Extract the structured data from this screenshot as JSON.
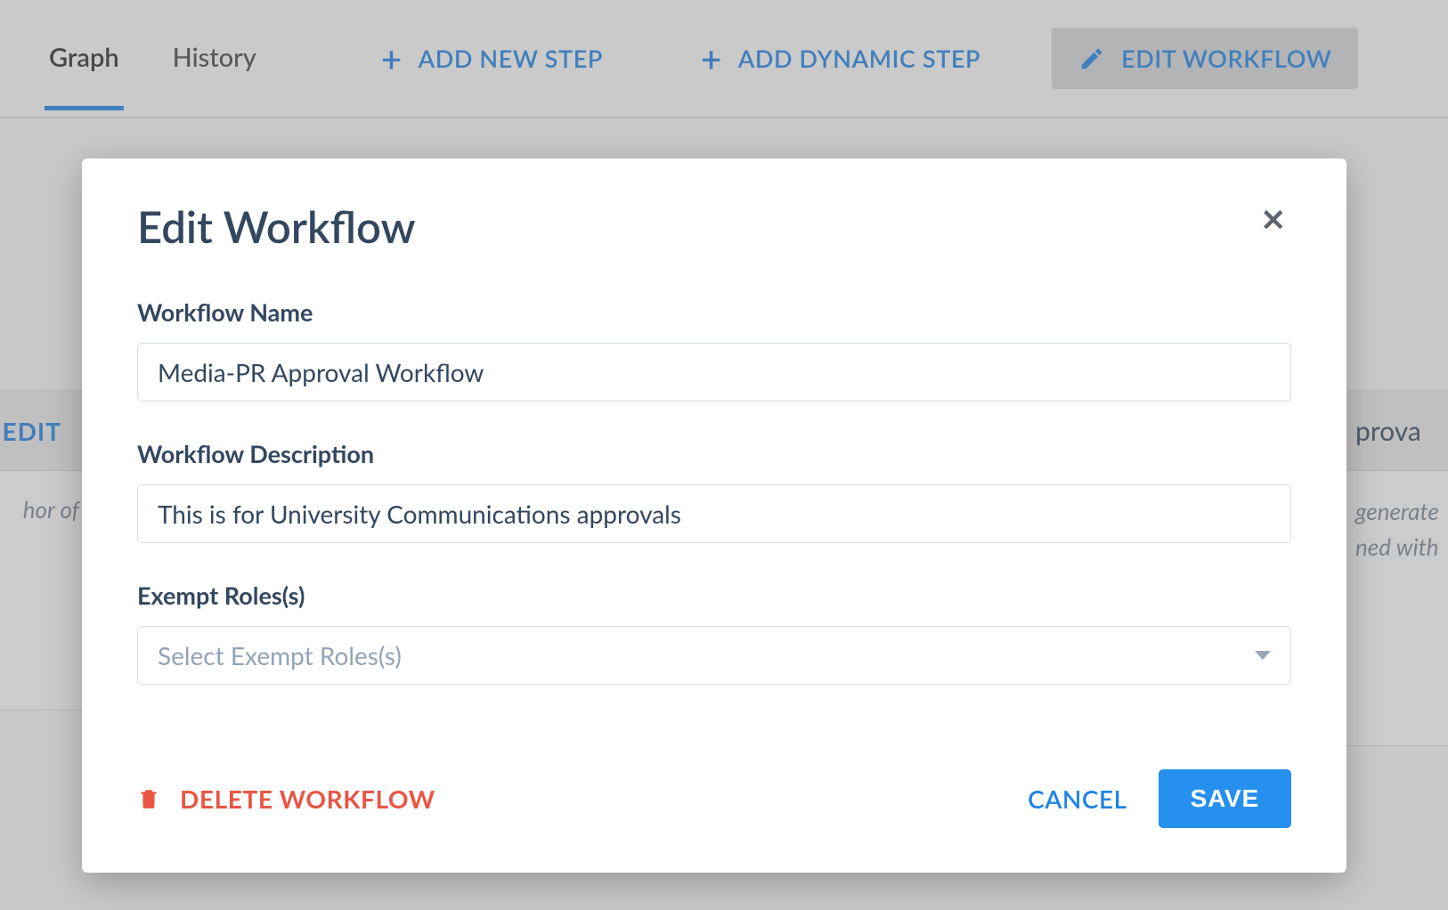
{
  "tabs": {
    "graph": "Graph",
    "history": "History"
  },
  "topbar": {
    "add_new_step": "ADD NEW STEP",
    "add_dynamic_step": "ADD DYNAMIC STEP",
    "edit_workflow": "EDIT WORKFLOW"
  },
  "background": {
    "left_edit": "EDIT",
    "left_text": "hor of",
    "right_title": "prova",
    "right_line1": " generate",
    "right_line2": "ned with"
  },
  "modal": {
    "title": "Edit Workflow",
    "labels": {
      "name": "Workflow Name",
      "description": "Workflow Description",
      "exempt": "Exempt Roles(s)"
    },
    "values": {
      "name": "Media-PR Approval Workflow",
      "description": "This is for University Communications approvals"
    },
    "exempt_placeholder": "Select Exempt Roles(s)",
    "buttons": {
      "delete": "DELETE WORKFLOW",
      "cancel": "CANCEL",
      "save": "SAVE"
    }
  }
}
